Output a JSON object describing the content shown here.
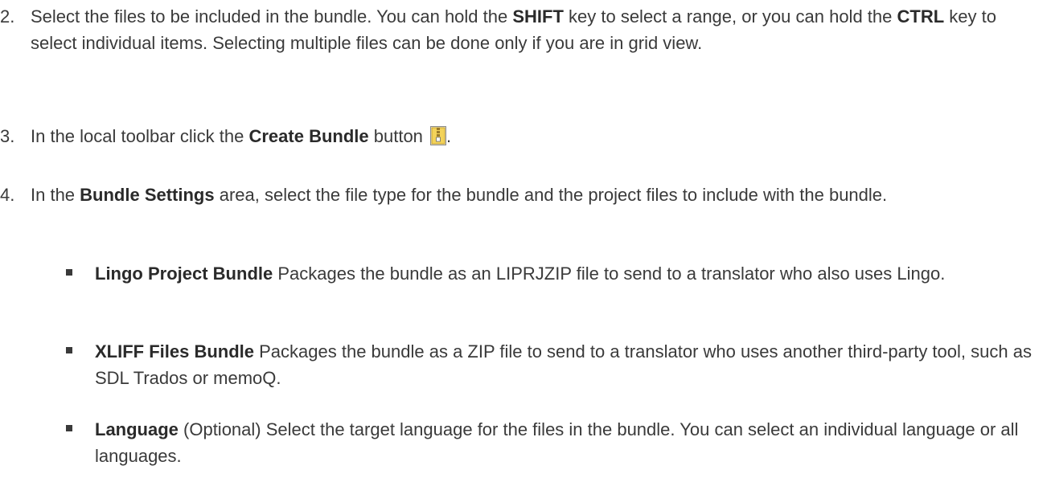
{
  "steps": [
    {
      "num": "2.",
      "parts": [
        "Select the files to be included in the bundle. You can hold the ",
        "SHIFT",
        " key to select a range, or you can hold the ",
        "CTRL",
        " key to select individual items. Selecting multiple files can be done only if you are in grid view."
      ]
    },
    {
      "num": "3.",
      "parts": [
        "In the local toolbar click the ",
        "Create Bundle",
        " button ",
        "."
      ],
      "icon": "zip-bundle-icon"
    },
    {
      "num": "4.",
      "parts": [
        "In the ",
        "Bundle Settings",
        " area, select the file type for the bundle and the project files to include with the bundle."
      ]
    }
  ],
  "bullets": [
    {
      "term": "Lingo Project Bundle",
      "desc": " Packages the bundle as an LIPRJZIP file to send to a translator who also uses Lingo."
    },
    {
      "term": "XLIFF Files Bundle",
      "desc": " Packages the bundle as a ZIP file to send to a translator who uses another third-party tool, such as SDL Trados or memoQ."
    },
    {
      "term": "Language",
      "desc": " (Optional) Select the target language for the files in the bundle. You can select an individual language or all languages."
    }
  ]
}
